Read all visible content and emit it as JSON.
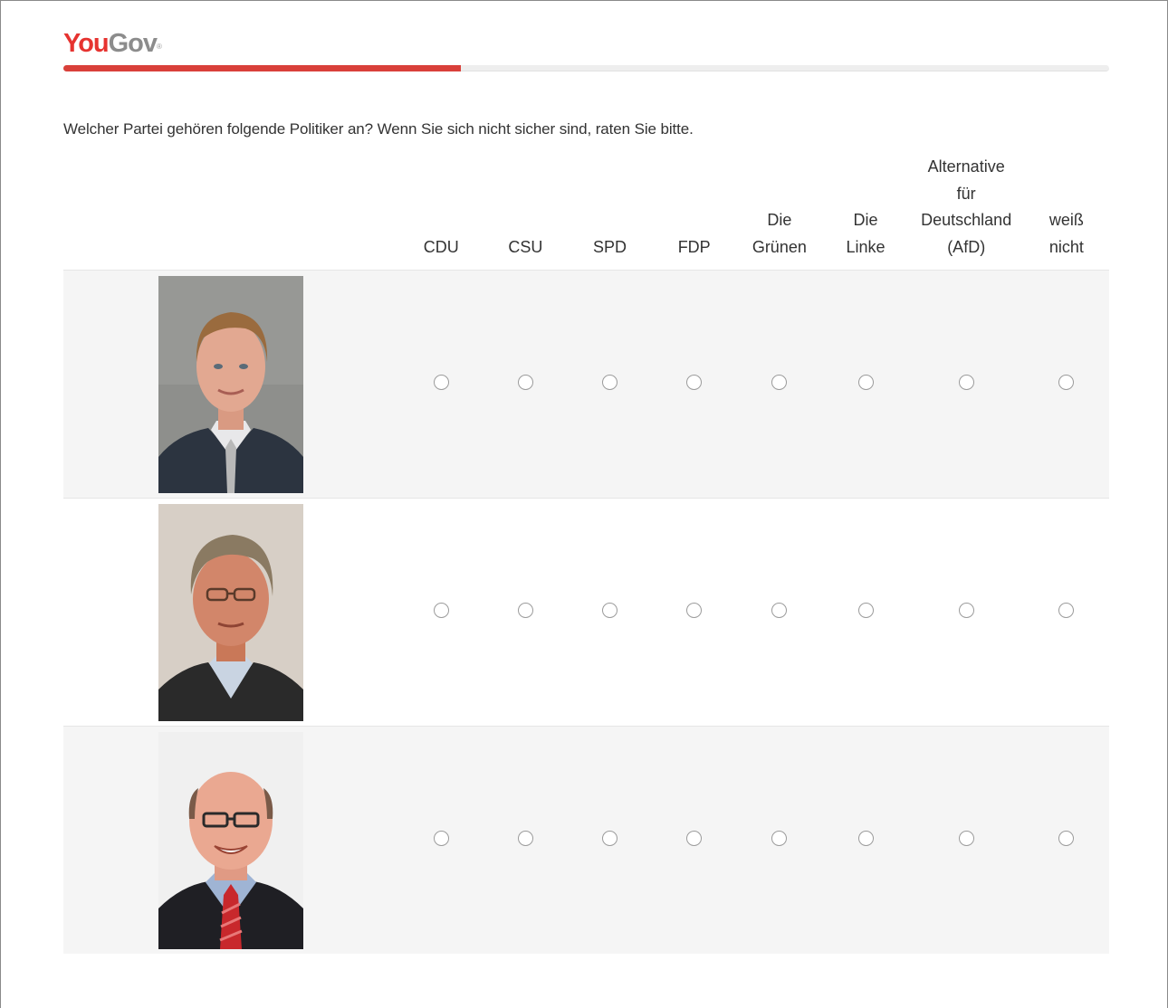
{
  "brand": {
    "name_part1": "You",
    "name_part2": "Gov",
    "registered_mark": "®"
  },
  "progress": {
    "fraction": 0.38
  },
  "question": {
    "text": "Welcher Partei gehören folgende Politiker an? Wenn Sie sich nicht sicher sind, raten Sie bitte."
  },
  "columns": [
    {
      "lines": [
        "CDU"
      ]
    },
    {
      "lines": [
        "CSU"
      ]
    },
    {
      "lines": [
        "SPD"
      ]
    },
    {
      "lines": [
        "FDP"
      ]
    },
    {
      "lines": [
        "Die",
        "Grünen"
      ]
    },
    {
      "lines": [
        "Die",
        "Linke"
      ]
    },
    {
      "lines": [
        "Alternative",
        "für",
        "Deutschland",
        "(AfD)"
      ]
    },
    {
      "lines": [
        "weiß",
        "nicht"
      ]
    }
  ],
  "rows": [
    {
      "photo_icon": "politician-portrait-1",
      "selected": null
    },
    {
      "photo_icon": "politician-portrait-2",
      "selected": null
    },
    {
      "photo_icon": "politician-portrait-3",
      "selected": null
    }
  ],
  "colors": {
    "brand_red": "#e63330",
    "brand_gray": "#8c8c8c",
    "progress_fill": "#d9403a",
    "row_shade": "#f5f5f5"
  }
}
